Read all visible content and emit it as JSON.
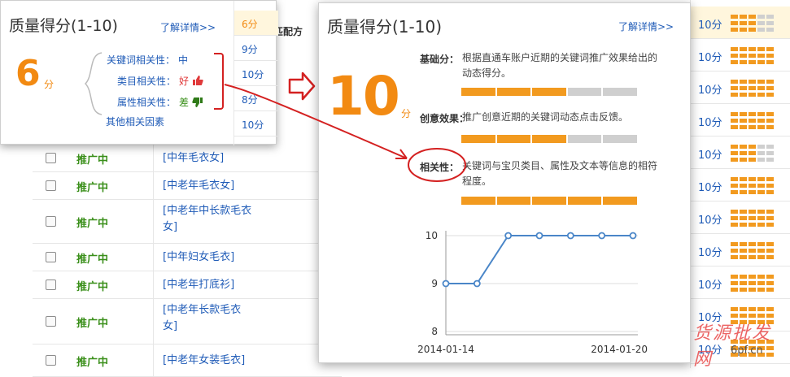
{
  "background": {
    "column_header": "关键词匹配方",
    "rows": [
      {
        "status": "推广中",
        "keyword": "[中年毛衣女]"
      },
      {
        "status": "推广中",
        "keyword": "[中老年毛衣女]"
      },
      {
        "status": "推广中",
        "keyword": "[中老年中长款毛衣女]"
      },
      {
        "status": "推广中",
        "keyword": "[中年妇女毛衣]"
      },
      {
        "status": "推广中",
        "keyword": "[中老年打底衫]"
      },
      {
        "status": "推广中",
        "keyword": "[中老年长款毛衣女]"
      },
      {
        "status": "推广中",
        "keyword": "[中老年女装毛衣]"
      }
    ],
    "score_column": [
      {
        "score": "10分",
        "level": 0.6
      },
      {
        "score": "10分",
        "level": 1.0
      },
      {
        "score": "10分",
        "level": 1.0
      },
      {
        "score": "10分",
        "level": 1.0
      },
      {
        "score": "10分",
        "level": 0.6
      },
      {
        "score": "10分",
        "level": 1.0
      },
      {
        "score": "10分",
        "level": 1.0
      },
      {
        "score": "10分",
        "level": 1.0
      },
      {
        "score": "10分",
        "level": 1.0
      },
      {
        "score": "10分",
        "level": 1.0
      },
      {
        "score": "10分",
        "level": 1.0
      }
    ]
  },
  "popup_small": {
    "title": "质量得分(1-10)",
    "detail_link": "了解详情>>",
    "score": "6",
    "unit": "分",
    "factors": [
      {
        "label": "关键词相关性：",
        "value": "中"
      },
      {
        "label": "类目相关性：",
        "value": "好"
      },
      {
        "label": "属性相关性：",
        "value": "差"
      }
    ],
    "other": "其他相关因素",
    "side_scores": [
      "6分",
      "9分",
      "10分",
      "8分",
      "10分"
    ]
  },
  "popup_big": {
    "title": "质量得分(1-10)",
    "detail_link": "了解详情>>",
    "score": "10",
    "unit": "分",
    "metrics": [
      {
        "label": "基础分：",
        "desc": "根据直通车账户近期的关键词推广效果给出的动态得分。",
        "level": 0.6
      },
      {
        "label": "创意效果：",
        "desc": "推广创意近期的关键词动态点击反馈。",
        "level": 0.6
      },
      {
        "label": "相关性：",
        "desc": "关键词与宝贝类目、属性及文本等信息的相符程度。",
        "level": 1.0
      }
    ]
  },
  "chart_data": {
    "type": "line",
    "x": [
      "2014-01-14",
      "2014-01-15",
      "2014-01-16",
      "2014-01-17",
      "2014-01-18",
      "2014-01-19",
      "2014-01-20"
    ],
    "x_tick_labels": [
      "2014-01-14",
      "2014-01-20"
    ],
    "y_ticks": [
      "10",
      "9",
      "8"
    ],
    "ylim": [
      8,
      10
    ],
    "series": [
      {
        "values": [
          9,
          9,
          10,
          10,
          10,
          10,
          10
        ],
        "color": "#4a86c8"
      }
    ],
    "grid": true
  },
  "watermark": {
    "text": "货源批发网",
    "sub": "6pf.cn"
  },
  "colors": {
    "accent": "#f28a12",
    "link": "#1f5bb7",
    "annotation": "#d42121",
    "bar_on": "#f29a1f",
    "bar_off": "#cfcfcf"
  }
}
